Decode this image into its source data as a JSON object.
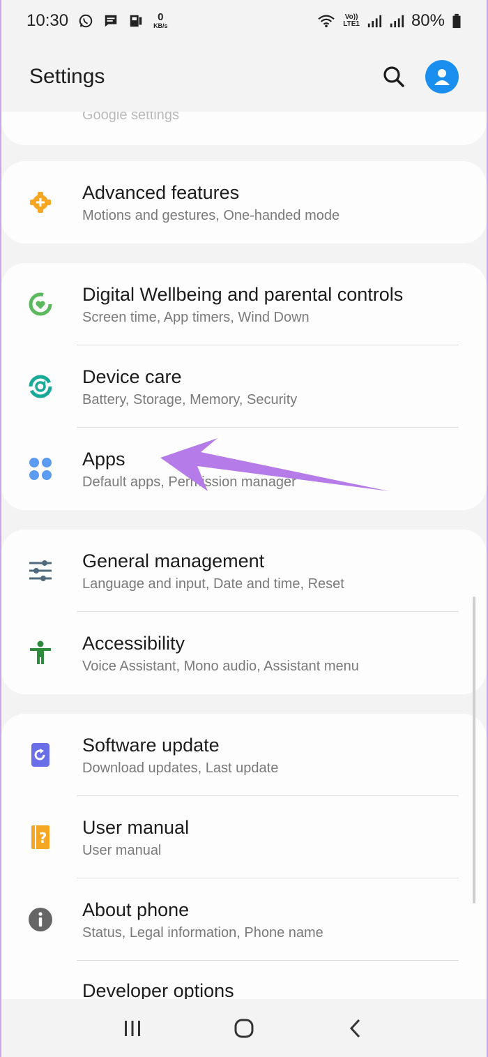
{
  "status_bar": {
    "time": "10:30",
    "data_speed_value": "0",
    "data_speed_unit": "KB/s",
    "volte_label_top": "Vo))",
    "volte_label_bottom": "LTE1",
    "battery": "80%"
  },
  "header": {
    "title": "Settings"
  },
  "partial_item": {
    "label": "Google settings"
  },
  "groups": [
    {
      "items": [
        {
          "title": "Advanced features",
          "subtitle": "Motions and gestures, One-handed mode",
          "icon": "gear-plus-icon",
          "icon_color": "#f5a623"
        }
      ]
    },
    {
      "items": [
        {
          "title": "Digital Wellbeing and parental controls",
          "subtitle": "Screen time, App timers, Wind Down",
          "icon": "wellbeing-icon",
          "icon_color": "#5cb85c"
        },
        {
          "title": "Device care",
          "subtitle": "Battery, Storage, Memory, Security",
          "icon": "device-care-icon",
          "icon_color": "#18a999"
        },
        {
          "title": "Apps",
          "subtitle": "Default apps, Permission manager",
          "icon": "apps-grid-icon",
          "icon_color": "#5b9cf0"
        }
      ]
    },
    {
      "items": [
        {
          "title": "General management",
          "subtitle": "Language and input, Date and time, Reset",
          "icon": "sliders-icon",
          "icon_color": "#4f6a7c"
        },
        {
          "title": "Accessibility",
          "subtitle": "Voice Assistant, Mono audio, Assistant menu",
          "icon": "accessibility-icon",
          "icon_color": "#2e8b3e"
        }
      ]
    },
    {
      "items": [
        {
          "title": "Software update",
          "subtitle": "Download updates, Last update",
          "icon": "software-update-icon",
          "icon_color": "#6a6ee8"
        },
        {
          "title": "User manual",
          "subtitle": "User manual",
          "icon": "user-manual-icon",
          "icon_color": "#f5a623"
        },
        {
          "title": "About phone",
          "subtitle": "Status, Legal information, Phone name",
          "icon": "info-icon",
          "icon_color": "#666666"
        },
        {
          "title": "Developer options",
          "subtitle": "",
          "icon": "developer-options-icon",
          "icon_color": "#555555"
        }
      ]
    }
  ],
  "colors": {
    "accent": "#1a8ff0",
    "annotation_arrow": "#b57be8"
  }
}
